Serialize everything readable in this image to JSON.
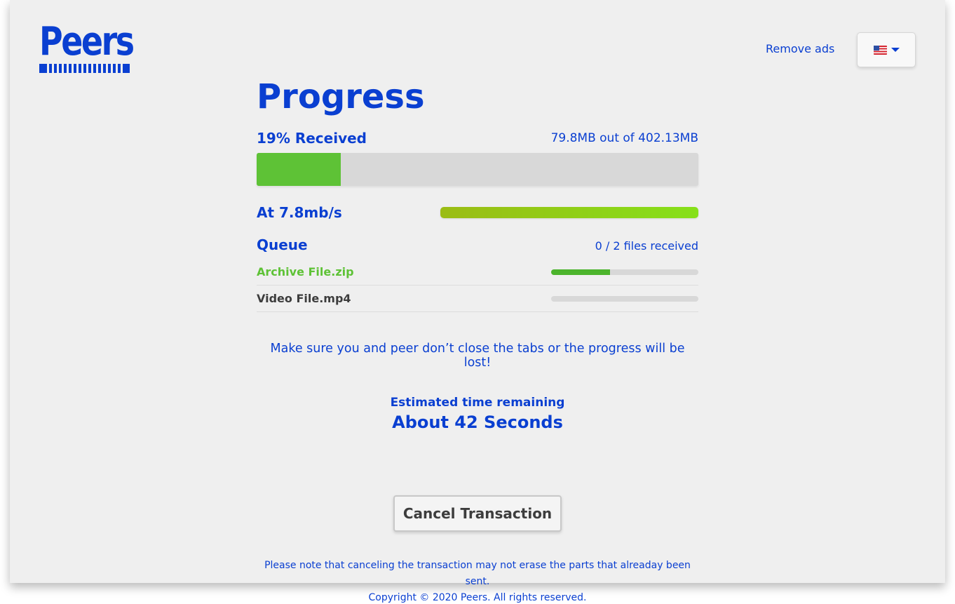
{
  "header": {
    "logo_text": "Peers",
    "remove_ads": "Remove ads",
    "language": {
      "selected": "US",
      "icon": "us-flag-icon"
    }
  },
  "progress": {
    "title": "Progress",
    "percent_label": "19% Received",
    "percent_value": 19,
    "size_label": "79.8MB out of 402.13MB",
    "speed_label": "At 7.8mb/s"
  },
  "queue": {
    "title": "Queue",
    "count_label": "0 / 2 files received",
    "files": [
      {
        "name": "Archive File.zip",
        "progress": 40
      },
      {
        "name": "Video File.mp4",
        "progress": 0
      }
    ]
  },
  "warning": "Make sure you and peer don’t close the tabs or the progress will be lost!",
  "eta": {
    "label": "Estimated time remaining",
    "value": "About 42 Seconds"
  },
  "cancel_label": "Cancel Transaction",
  "footer": {
    "note": "Please note that canceling the transaction may not erase the parts that alreaday been sent.",
    "copyright": "Copyright © 2020 Peers. All rights reserved."
  },
  "colors": {
    "brand": "#0a3fd1",
    "success": "#5ec236",
    "background": "#efefef"
  }
}
